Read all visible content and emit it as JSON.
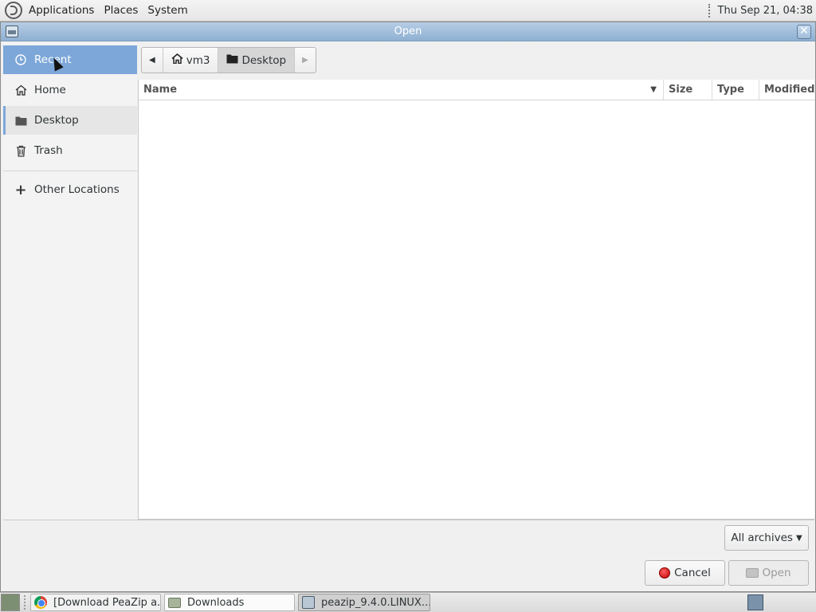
{
  "top_panel": {
    "menus": [
      "Applications",
      "Places",
      "System"
    ],
    "clock": "Thu Sep 21, 04:38",
    "logo_icon": "mate-logo-icon"
  },
  "dialog": {
    "title": "Open",
    "close_icon": "close-icon",
    "sidebar": {
      "places": [
        {
          "label": "Recent",
          "icon": "clock-icon",
          "selected": true
        },
        {
          "label": "Home",
          "icon": "home-icon"
        },
        {
          "label": "Desktop",
          "icon": "folder-icon",
          "current": true
        },
        {
          "label": "Trash",
          "icon": "trash-icon"
        }
      ],
      "other_locations": "Other Locations"
    },
    "pathbar": {
      "crumbs": [
        {
          "label": "vm3",
          "icon": "home-icon"
        },
        {
          "label": "Desktop",
          "icon": "folder-icon",
          "active": true
        }
      ]
    },
    "file_list": {
      "columns": [
        "Name",
        "Size",
        "Type",
        "Modified"
      ],
      "rows": []
    },
    "filter": {
      "label": "All archives"
    },
    "buttons": {
      "cancel": "Cancel",
      "open": "Open"
    }
  },
  "taskbar": {
    "tasks": [
      {
        "label": "[Download PeaZip a...",
        "icon": "chrome-icon"
      },
      {
        "label": "Downloads",
        "icon": "folder-icon"
      },
      {
        "label": "peazip_9.4.0.LINUX....",
        "icon": "peazip-icon"
      }
    ]
  },
  "colors": {
    "selection": "#7da7d9",
    "titlebar": "#8fb0d2"
  }
}
